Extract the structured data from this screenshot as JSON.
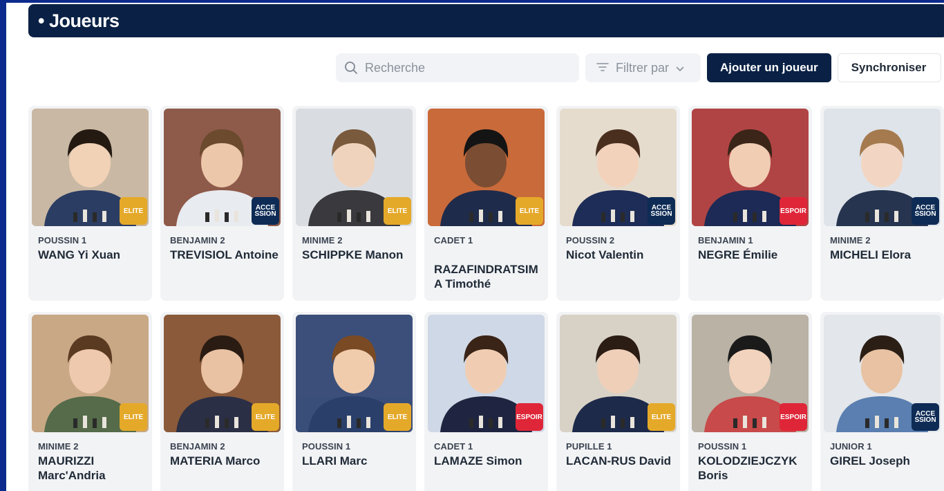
{
  "header": {
    "title": "• Joueurs"
  },
  "toolbar": {
    "search_placeholder": "Recherche",
    "filter_label": "Filtrer par",
    "add_label": "Ajouter un joueur",
    "sync_label": "Synchroniser"
  },
  "colors": {
    "navy": "#0a2145",
    "elite": "#e5a92a",
    "accession": "#0d2b55",
    "espoir": "#df2638"
  },
  "players": [
    {
      "category": "POUSSIN 1",
      "name": "WANG Yi Xuan",
      "badge": "ELITE",
      "badge_type": "elite"
    },
    {
      "category": "BENJAMIN 2",
      "name": "TREVISIOL Antoine",
      "badge": "ACCE SSION",
      "badge_type": "accession"
    },
    {
      "category": "MINIME 2",
      "name": "SCHIPPKE Manon",
      "badge": "ELITE",
      "badge_type": "elite"
    },
    {
      "category": "CADET 1",
      "name": "RAZAFINDRATSIMA Timothé",
      "badge": "ELITE",
      "badge_type": "elite"
    },
    {
      "category": "POUSSIN 2",
      "name": "Nicot Valentin",
      "badge": "ACCE SSION",
      "badge_type": "accession"
    },
    {
      "category": "BENJAMIN 1",
      "name": "NEGRE Émilie",
      "badge": "ESPOIR",
      "badge_type": "espoir"
    },
    {
      "category": "MINIME 2",
      "name": "MICHELI Elora",
      "badge": "ACCE SSION",
      "badge_type": "accession"
    },
    {
      "category": "MINIME 2",
      "name": "MAURIZZI Marc'Andria",
      "badge": "ELITE",
      "badge_type": "elite"
    },
    {
      "category": "BENJAMIN 2",
      "name": "MATERIA Marco",
      "badge": "ELITE",
      "badge_type": "elite"
    },
    {
      "category": "POUSSIN 1",
      "name": "LLARI Marc",
      "badge": "ELITE",
      "badge_type": "elite"
    },
    {
      "category": "CADET 1",
      "name": "LAMAZE Simon",
      "badge": "ESPOIR",
      "badge_type": "espoir"
    },
    {
      "category": "PUPILLE 1",
      "name": "LACAN-RUS David",
      "badge": "ELITE",
      "badge_type": "elite"
    },
    {
      "category": "POUSSIN 1",
      "name": "KOLODZIEJCZYK Boris",
      "badge": "ESPOIR",
      "badge_type": "espoir"
    },
    {
      "category": "JUNIOR 1",
      "name": "GIREL Joseph",
      "badge": "ACCE SSION",
      "badge_type": "accession"
    }
  ]
}
